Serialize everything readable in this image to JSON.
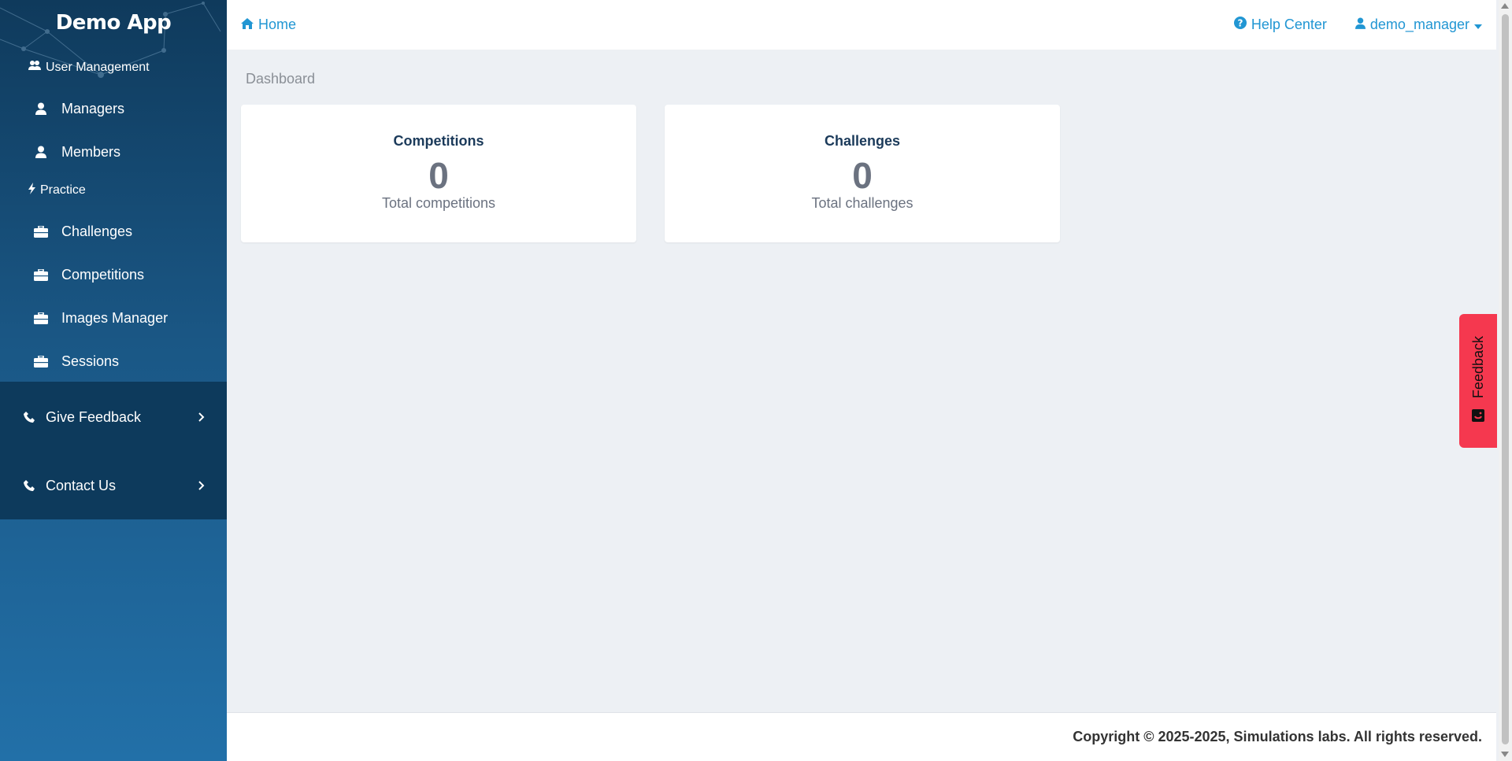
{
  "app": {
    "title": "Demo App"
  },
  "sidebar": {
    "sections": [
      {
        "title": "User Management",
        "icon": "users-icon",
        "items": [
          {
            "label": "Managers",
            "icon": "user-icon"
          },
          {
            "label": "Members",
            "icon": "user-icon"
          }
        ]
      },
      {
        "title": "Practice",
        "icon": "bolt-icon",
        "items": [
          {
            "label": "Challenges",
            "icon": "briefcase-icon"
          },
          {
            "label": "Competitions",
            "icon": "briefcase-icon"
          },
          {
            "label": "Images Manager",
            "icon": "briefcase-icon"
          },
          {
            "label": "Sessions",
            "icon": "briefcase-icon"
          }
        ]
      }
    ],
    "give_feedback": {
      "label": "Give Feedback",
      "icon": "phone-icon"
    },
    "contact_us": {
      "label": "Contact Us",
      "icon": "phone-icon"
    }
  },
  "header": {
    "home_label": "Home",
    "help_label": "Help Center",
    "user_label": "demo_manager"
  },
  "breadcrumb": "Dashboard",
  "cards": [
    {
      "title": "Competitions",
      "value": "0",
      "subtitle": "Total competitions"
    },
    {
      "title": "Challenges",
      "value": "0",
      "subtitle": "Total challenges"
    }
  ],
  "footer": {
    "copyright": "Copyright © 2025-2025, Simulations labs. All rights reserved."
  },
  "feedback_tab": {
    "label": "Feedback"
  },
  "colors": {
    "accent": "#2196d3",
    "feedback": "#f5384f",
    "sidebar_dark": "#0d3a5c"
  }
}
